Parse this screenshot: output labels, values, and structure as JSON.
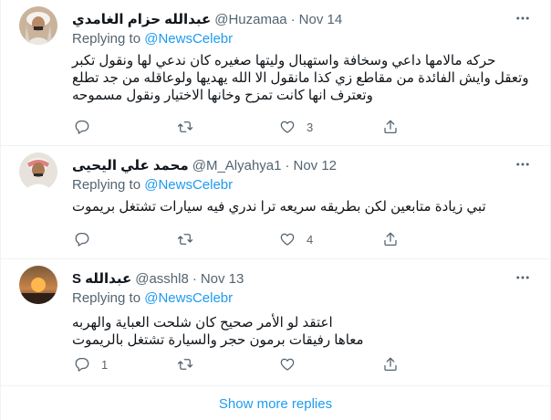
{
  "tweets": [
    {
      "name": "عبدالله حزام الغامدي",
      "handle": "@Huzamaa",
      "time": "Nov 14",
      "replying_prefix": "Replying to",
      "mention": "@NewsCelebr",
      "lines": [
        "حركه مالامها داعي وسخافة واستهبال وليتها صغيره كان ندعي لها ونقول تكبر",
        "وتعقل وايش الفائدة من مقاطع زي كذا مانقول الا الله يهديها ولوعاقله من جد تطلع",
        "وتعترف انها كانت تمزح وخانها الاختيار ونقول مسموحه"
      ],
      "replies": "",
      "retweets": "",
      "likes": "3"
    },
    {
      "name": "محمد علي اليحيى",
      "handle": "@M_Alyahya1",
      "time": "Nov 12",
      "replying_prefix": "Replying to",
      "mention": "@NewsCelebr",
      "lines": [
        "تبي زيادة متابعين  لكن بطريقه سريعه ترا ندري فيه سيارات تشتغل بريموت"
      ],
      "replies": "",
      "retweets": "",
      "likes": "4"
    },
    {
      "name": "عبدالله S",
      "handle": "@asshl8",
      "time": "Nov 13",
      "replying_prefix": "Replying to",
      "mention": "@NewsCelebr",
      "lines": [
        "اعتقد لو الأمر صحيح كان شلحت العباية والهربه",
        "معاها رفيقات برمون حجر والسيارة تشتغل بالريموت"
      ],
      "replies": "1",
      "retweets": "",
      "likes": ""
    }
  ],
  "show_more": "Show more replies",
  "colors": {
    "accent": "#1d9bf0",
    "secondary_text": "#536471",
    "divider": "#eff3f4"
  },
  "icons": [
    "more-icon",
    "reply-icon",
    "retweet-icon",
    "like-icon",
    "share-icon"
  ]
}
